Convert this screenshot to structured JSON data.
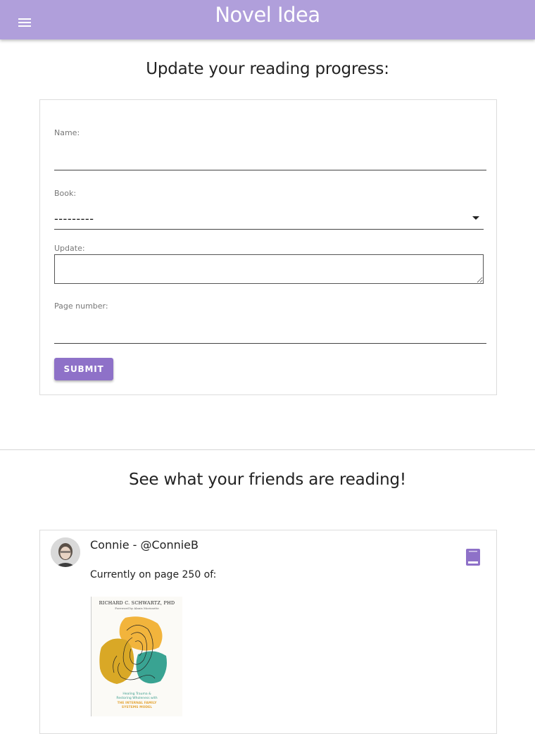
{
  "app": {
    "title": "Novel Idea",
    "brand_color": "#b09fdb",
    "accent_color": "#8e71c8",
    "menu_icon": "hamburger-menu-icon"
  },
  "update_form": {
    "heading": "Update your reading progress:",
    "name_label": "Name:",
    "name_value": "",
    "book_label": "Book:",
    "book_selected": "---------",
    "update_label": "Update:",
    "update_value": "",
    "page_label": "Page number:",
    "page_value": "",
    "submit_label": "SUBMIT"
  },
  "friends": {
    "heading": "See what your friends are reading!",
    "items": [
      {
        "display": "Connie - @ConnieB",
        "progress_text": "Currently on page 250 of:",
        "page": 250,
        "action_icon": "book-icon",
        "cover": {
          "author": "RICHARD C. SCHWARTZ, PHD",
          "foreword": "Foreword by Alanis Morissette",
          "subtitle_line1": "Healing Trauma &",
          "subtitle_line2": "Restoring Wholeness with",
          "subtitle_line3": "THE INTERNAL FAMILY",
          "subtitle_line4": "SYSTEMS MODEL"
        }
      }
    ]
  }
}
